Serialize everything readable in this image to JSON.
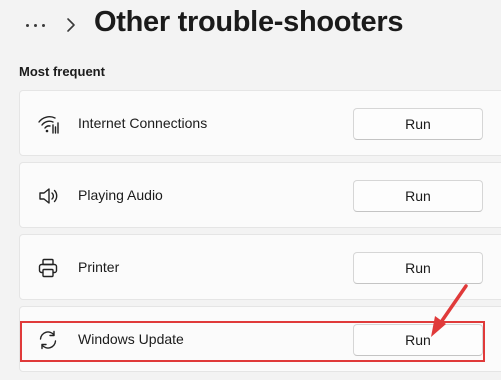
{
  "header": {
    "more_icon": "more-horizontal-icon",
    "chevron_icon": "chevron-right-icon",
    "title": "Other trouble-shooters"
  },
  "section": {
    "title": "Most frequent"
  },
  "items": [
    {
      "label": "Internet Connections",
      "icon": "wifi-icon",
      "button": "Run"
    },
    {
      "label": "Playing Audio",
      "icon": "speaker-icon",
      "button": "Run"
    },
    {
      "label": "Printer",
      "icon": "printer-icon",
      "button": "Run"
    },
    {
      "label": "Windows Update",
      "icon": "sync-icon",
      "button": "Run"
    }
  ],
  "annotation": {
    "highlight_color": "#e03a3a"
  }
}
